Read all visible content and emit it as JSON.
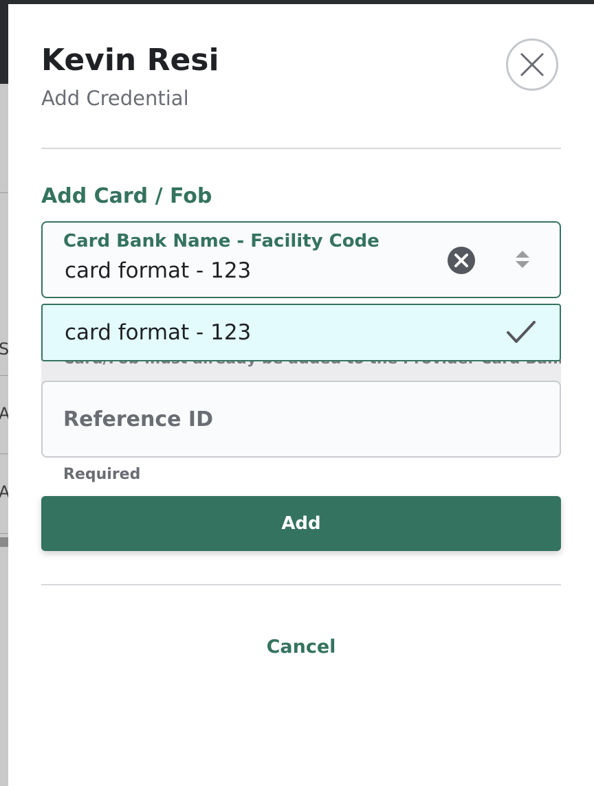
{
  "header": {
    "title": "Kevin Resi",
    "subtitle": "Add Credential"
  },
  "form": {
    "section_title": "Add Card / Fob",
    "card_bank_select": {
      "label": "Card Bank Name - Facility Code",
      "value": "card format - 123"
    },
    "dropdown": {
      "options": [
        {
          "label": "card format - 123",
          "selected": true
        }
      ]
    },
    "hint": "Card/Fob must already be added to the Provider Card Bank.",
    "reference_id": {
      "placeholder": "Reference ID",
      "value": "",
      "helper": "Required"
    },
    "add_label": "Add",
    "cancel_label": "Cancel"
  },
  "backdrop": {
    "fragments": [
      "S",
      "A",
      "A"
    ]
  },
  "colors": {
    "accent": "#34735f",
    "text": "#1f2125",
    "muted": "#6a6d73",
    "option_highlight": "#e3fbfc"
  },
  "icons": {
    "close": "close-icon",
    "clear": "clear-circle-icon",
    "sort": "sort-arrows-icon",
    "check": "checkmark-icon"
  }
}
